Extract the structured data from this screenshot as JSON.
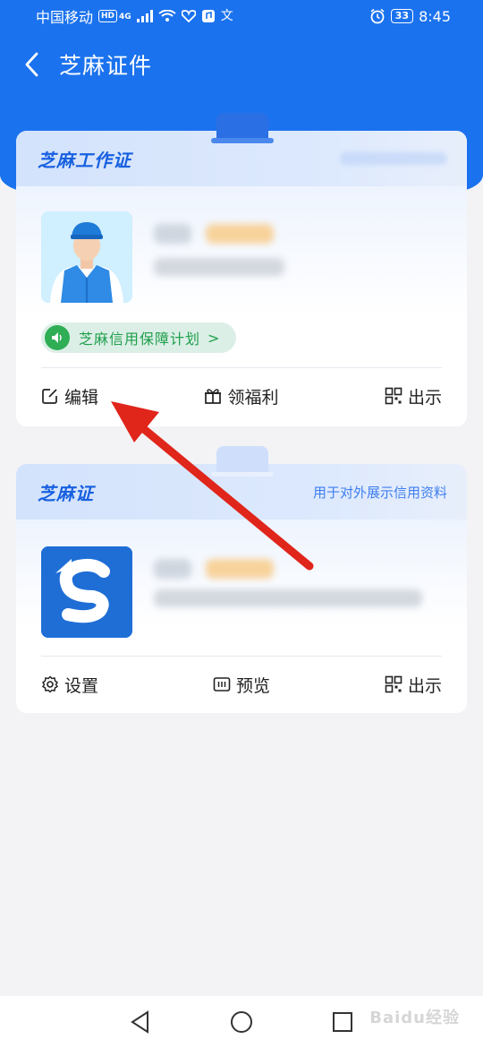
{
  "status_bar": {
    "carrier": "中国移动",
    "hd_badge": "HD",
    "network": "4G",
    "battery": "33",
    "time": "8:45",
    "icons": [
      "signal-icon",
      "wifi-icon",
      "heart-icon",
      "music-app-icon",
      "translate-icon",
      "alarm-icon"
    ]
  },
  "nav": {
    "title": "芝麻证件",
    "back_icon": "chevron-left-icon"
  },
  "work_card": {
    "title": "芝麻工作证",
    "pill_label": "芝麻信用保障计划",
    "pill_arrow": ">",
    "actions": [
      {
        "label": "编辑",
        "icon": "edit-icon"
      },
      {
        "label": "领福利",
        "icon": "gift-icon"
      },
      {
        "label": "出示",
        "icon": "qr-code-icon"
      }
    ]
  },
  "zhima_card": {
    "title": "芝麻证",
    "subtitle": "用于对外展示信用资料",
    "actions": [
      {
        "label": "设置",
        "icon": "settings-icon"
      },
      {
        "label": "预览",
        "icon": "preview-icon"
      },
      {
        "label": "出示",
        "icon": "qr-code-icon"
      }
    ]
  },
  "bottom_nav": {
    "icons": [
      "back-triangle-icon",
      "home-circle-icon",
      "recents-square-icon"
    ]
  },
  "watermark": "Baidu经验",
  "colors": {
    "primary_blue": "#1b72ee",
    "title_blue": "#1760e0",
    "green": "#1e9f4a",
    "arrow_red": "#e0251b",
    "background": "#f3f3f5"
  }
}
